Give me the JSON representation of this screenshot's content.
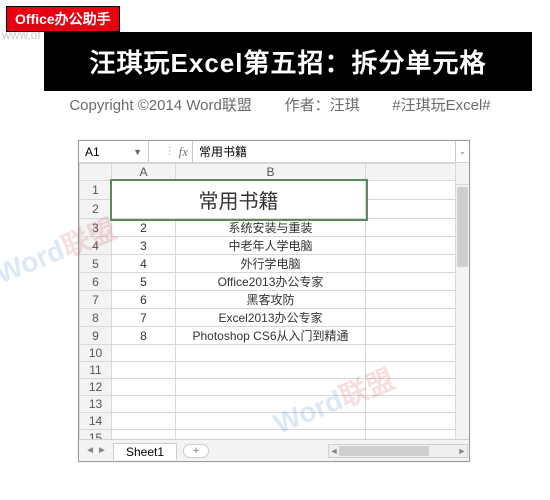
{
  "header": {
    "badge": "Office办公助手",
    "faded_url": "www.of",
    "title": "汪琪玩Excel第五招：拆分单元格"
  },
  "copyright": {
    "left": "Copyright ©2014 Word联盟",
    "author_label": "作者：汪琪",
    "hashtag": "#汪琪玩Excel#"
  },
  "excel": {
    "name_box": "A1",
    "fx_label": "fx",
    "formula_value": "常用书籍",
    "columns": [
      "A",
      "B"
    ],
    "merged_label": "常用书籍",
    "rows": [
      {
        "n": 3,
        "a": "2",
        "b": "系统安装与重装"
      },
      {
        "n": 4,
        "a": "3",
        "b": "中老年人学电脑"
      },
      {
        "n": 5,
        "a": "4",
        "b": "外行学电脑"
      },
      {
        "n": 6,
        "a": "5",
        "b": "Office2013办公专家"
      },
      {
        "n": 7,
        "a": "6",
        "b": "黑客攻防"
      },
      {
        "n": 8,
        "a": "7",
        "b": "Excel2013办公专家"
      },
      {
        "n": 9,
        "a": "8",
        "b": "Photoshop CS6从入门到精通"
      }
    ],
    "empty_rows": [
      10,
      11,
      12,
      13,
      14,
      15
    ],
    "sheet_tab": "Sheet1"
  },
  "watermark": {
    "word": "Word",
    "union": "联盟"
  }
}
